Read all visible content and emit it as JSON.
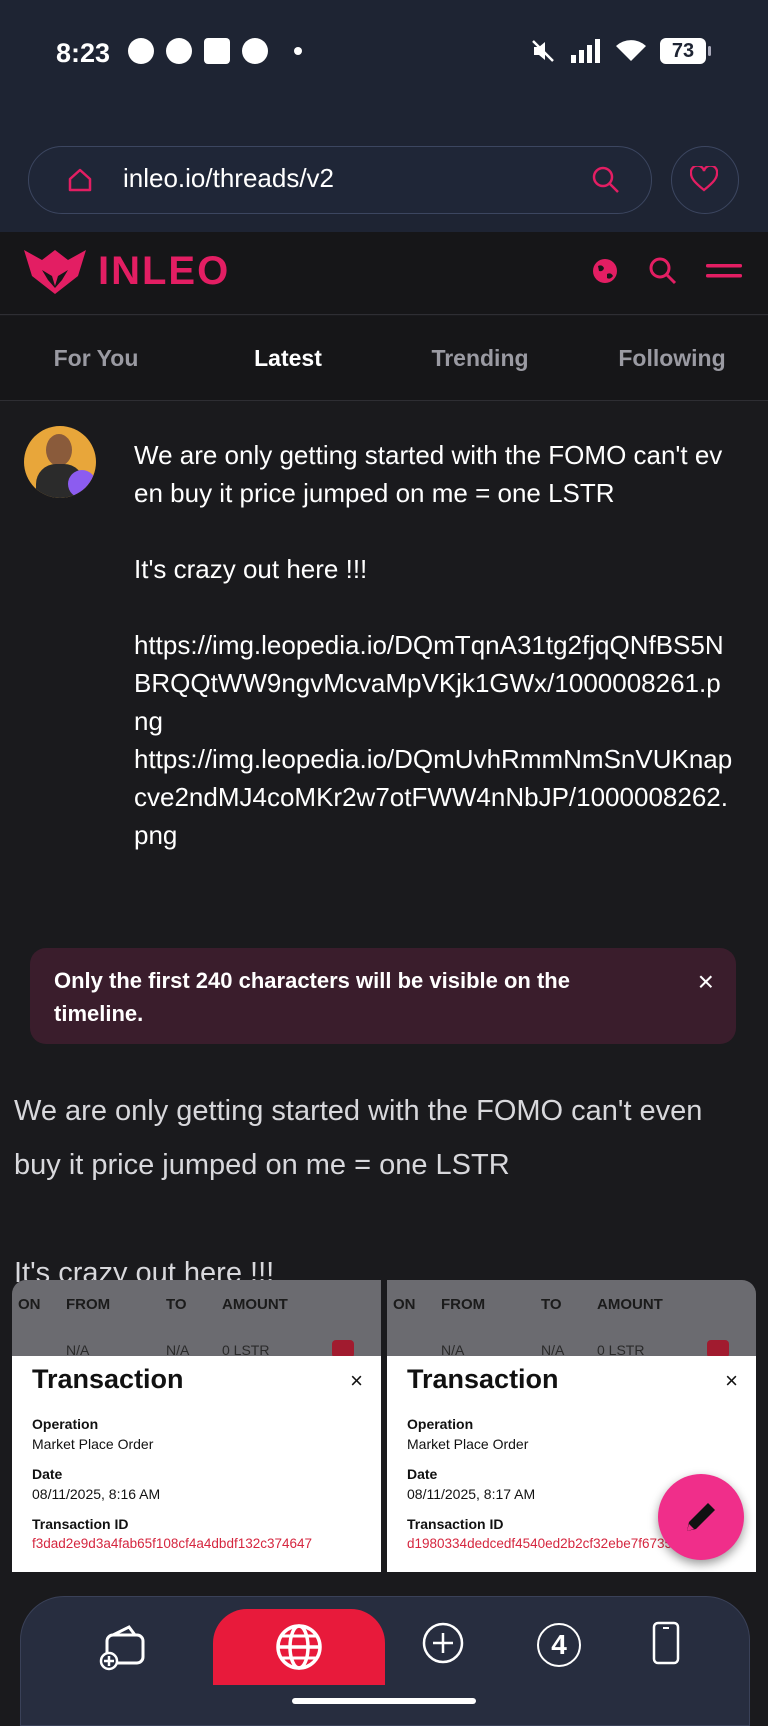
{
  "status": {
    "time": "8:23",
    "battery": "73"
  },
  "browser": {
    "url": "inleo.io/threads/v2"
  },
  "brand": {
    "name": "INLEO",
    "accent": "#e31e63"
  },
  "tabs": [
    {
      "label": "For You"
    },
    {
      "label": "Latest"
    },
    {
      "label": "Trending"
    },
    {
      "label": "Following"
    }
  ],
  "composer": {
    "text": "We are only getting started with the FOMO can't even buy it price jumped on me = one LSTR\n\nIt's crazy out here !!!\n\nhttps://img.leopedia.io/DQmTqnA31tg2fjqQNfBS5NBRQQtWW9ngvMcvaMpVKjk1GWx/1000008261.png\nhttps://img.leopedia.io/DQmUvhRmmNmSnVUKnapcve2ndMJ4coMKr2w7otFWW4nNbJP/1000008262.png"
  },
  "notice": {
    "text": "Only the first 240 characters will be visible on the timeline.",
    "close": "×"
  },
  "preview": {
    "text": "We are only getting started with the FOMO can't even buy it price jumped on me = one LSTR\n\nIt's crazy out here !!!"
  },
  "shots": [
    {
      "head": {
        "op": "ON",
        "from": "FROM",
        "to": "TO",
        "amount": "AMOUNT"
      },
      "row": {
        "from": "N/A",
        "to": "N/A",
        "amount": "0 LSTR"
      },
      "modal": {
        "title": "Transaction",
        "close": "×",
        "op_label": "Operation",
        "op_value": "Market Place Order",
        "date_label": "Date",
        "date_value": "08/11/2025, 8:16 AM",
        "txid_label": "Transaction ID",
        "txid_value": "f3dad2e9d3a4fab65f108cf4a4dbdf132c374647"
      }
    },
    {
      "head": {
        "op": "ON",
        "from": "FROM",
        "to": "TO",
        "amount": "AMOUNT"
      },
      "row": {
        "from": "N/A",
        "to": "N/A",
        "amount": "0 LSTR"
      },
      "modal": {
        "title": "Transaction",
        "close": "×",
        "op_label": "Operation",
        "op_value": "Market Place Order",
        "date_label": "Date",
        "date_value": "08/11/2025, 8:17 AM",
        "txid_label": "Transaction ID",
        "txid_value": "d1980334dedcedf4540ed2b2cf32ebe7f67352d0"
      }
    }
  ],
  "bottom_nav": {
    "notification_count": "4"
  }
}
